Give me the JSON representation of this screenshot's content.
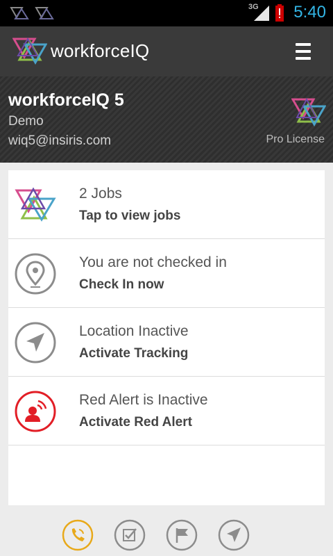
{
  "status_bar": {
    "network": "3G",
    "time": "5:40",
    "notification_icons": [
      "workforceiq-notification-icon",
      "workforceiq-notification-icon"
    ]
  },
  "action_bar": {
    "title": "workforceIQ",
    "menu_icon": "hamburger-menu-icon"
  },
  "profile": {
    "name": "workforceIQ 5",
    "organization": "Demo",
    "email": "wiq5@insiris.com",
    "license": "Pro License"
  },
  "rows": [
    {
      "title": "2 Jobs",
      "action": "Tap to view jobs",
      "icon": "workforceiq-logo-icon"
    },
    {
      "title": "You are not checked in",
      "action": "Check In now",
      "icon": "location-pin-icon"
    },
    {
      "title": "Location Inactive",
      "action": "Activate Tracking",
      "icon": "navigation-arrow-icon"
    },
    {
      "title": "Red Alert is Inactive",
      "action": "Activate Red Alert",
      "icon": "red-alert-icon"
    }
  ],
  "bottom_tabs": [
    {
      "icon": "phone-icon",
      "active": true
    },
    {
      "icon": "checklist-icon",
      "active": false
    },
    {
      "icon": "flag-icon",
      "active": false
    },
    {
      "icon": "navigation-arrow-icon",
      "active": false
    }
  ],
  "colors": {
    "clock": "#33b5e5",
    "active_tab": "#e8a91a",
    "red_alert": "#e21e26",
    "icon_gray": "#8c8c8c"
  }
}
